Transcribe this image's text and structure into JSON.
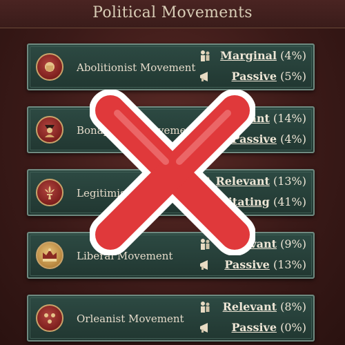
{
  "header": {
    "title": "Political Movements"
  },
  "movements": [
    {
      "name": "Abolitionist Movement",
      "support_label": "Marginal",
      "support_pct": "(4%)",
      "activism_label": "Passive",
      "activism_pct": "(5%)",
      "emblem": "fist-icon"
    },
    {
      "name": "Bonapartist Movement",
      "support_label": "Relevant",
      "support_pct": "(14%)",
      "activism_label": "Passive",
      "activism_pct": "(4%)",
      "emblem": "bust-icon"
    },
    {
      "name": "Legitimist Movement",
      "support_label": "Relevant",
      "support_pct": "(13%)",
      "activism_label": "Agitating",
      "activism_pct": "(41%)",
      "emblem": "fleur-de-lis-icon"
    },
    {
      "name": "Liberal Movement",
      "support_label": "Relevant",
      "support_pct": "(9%)",
      "activism_label": "Passive",
      "activism_pct": "(13%)",
      "emblem": "crown-icon"
    },
    {
      "name": "Orleanist Movement",
      "support_label": "Relevant",
      "support_pct": "(8%)",
      "activism_label": "Passive",
      "activism_pct": "(0%)",
      "emblem": "fleur-de-lis-trio-icon"
    }
  ],
  "overlay": {
    "icon": "red-x-icon",
    "color": "#e0393b"
  }
}
